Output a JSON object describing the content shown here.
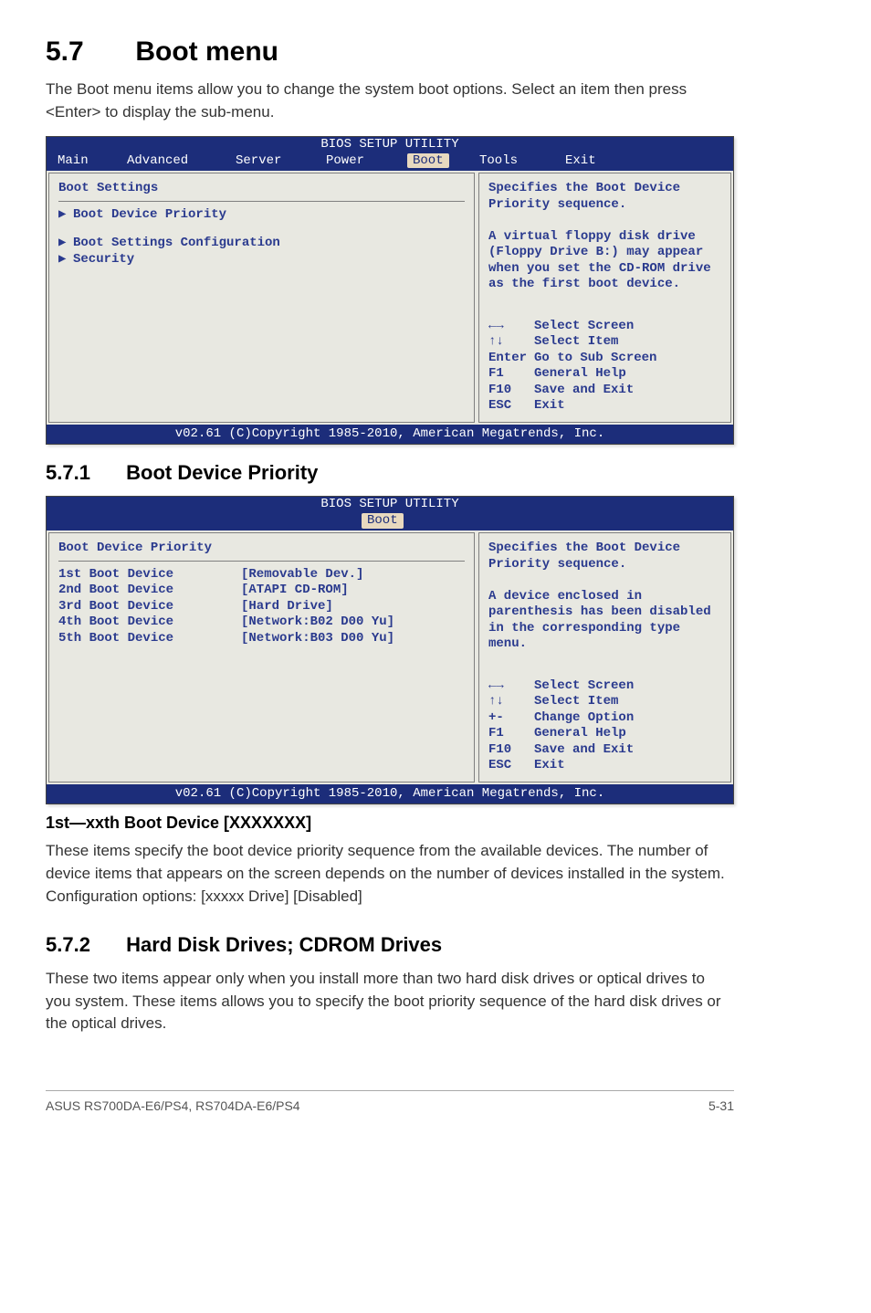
{
  "section": {
    "num": "5.7",
    "title": "Boot menu"
  },
  "intro": "The Boot menu items allow you to change the system boot options. Select an item then press <Enter> to display the sub-menu.",
  "bios1": {
    "title": "BIOS SETUP UTILITY",
    "menus": {
      "main": "Main",
      "advanced": "Advanced",
      "server": "Server",
      "power": "Power",
      "boot": "Boot",
      "tools": "Tools",
      "exit": "Exit"
    },
    "left": {
      "heading": "Boot Settings",
      "items": [
        {
          "arrow": "▶",
          "label": "Boot Device Priority"
        },
        {
          "arrow": " ",
          "label": ""
        },
        {
          "arrow": "▶",
          "label": "Boot Settings Configuration"
        },
        {
          "arrow": "▶",
          "label": "Security"
        }
      ]
    },
    "right": {
      "help": "Specifies the Boot Device Priority sequence.\n\nA virtual floppy disk drive (Floppy Drive B:) may appear when you set the CD-ROM drive as the first boot device.",
      "nav": [
        {
          "key": "←→",
          "desc": "Select Screen"
        },
        {
          "key": "↑↓",
          "desc": "Select Item"
        },
        {
          "key": "Enter",
          "desc": "Go to Sub Screen"
        },
        {
          "key": "F1",
          "desc": "General Help"
        },
        {
          "key": "F10",
          "desc": "Save and Exit"
        },
        {
          "key": "ESC",
          "desc": "Exit"
        }
      ]
    },
    "footer": "v02.61 (C)Copyright 1985-2010, American Megatrends, Inc."
  },
  "sub1": {
    "num": "5.7.1",
    "title": "Boot Device Priority"
  },
  "bios2": {
    "title": "BIOS SETUP UTILITY",
    "menu_boot": "Boot",
    "left": {
      "heading": "Boot Device Priority",
      "items": [
        {
          "label": "1st Boot Device",
          "value": "[Removable Dev.]"
        },
        {
          "label": "2nd Boot Device",
          "value": "[ATAPI CD-ROM]"
        },
        {
          "label": "3rd Boot Device",
          "value": "[Hard Drive]"
        },
        {
          "label": "4th Boot Device",
          "value": "[Network:B02 D00 Yu]"
        },
        {
          "label": "5th Boot Device",
          "value": "[Network:B03 D00 Yu]"
        }
      ]
    },
    "right": {
      "help": "Specifies the Boot Device Priority sequence.\n\nA device enclosed in parenthesis has been disabled in the corresponding type menu.",
      "nav": [
        {
          "key": "←→",
          "desc": "Select Screen"
        },
        {
          "key": "↑↓",
          "desc": "Select Item"
        },
        {
          "key": "+-",
          "desc": "Change Option"
        },
        {
          "key": "F1",
          "desc": "General Help"
        },
        {
          "key": "F10",
          "desc": "Save and Exit"
        },
        {
          "key": "ESC",
          "desc": "Exit"
        }
      ]
    },
    "footer": "v02.61 (C)Copyright 1985-2010, American Megatrends, Inc."
  },
  "setting1": {
    "title": "1st—xxth Boot Device [XXXXXXX]",
    "body": "These items specify the boot device priority sequence from the available devices. The number of device items that appears on the screen depends on the number of devices installed in the system. Configuration options: [xxxxx Drive] [Disabled]"
  },
  "sub2": {
    "num": "5.7.2",
    "title": "Hard Disk Drives; CDROM Drives"
  },
  "sub2_body": "These two items appear only when you install more than two hard disk drives or optical drives to you system. These items allows you to specify the boot priority sequence of the hard disk drives or the optical drives.",
  "footer": {
    "left": "ASUS RS700DA-E6/PS4, RS704DA-E6/PS4",
    "right": "5-31"
  }
}
